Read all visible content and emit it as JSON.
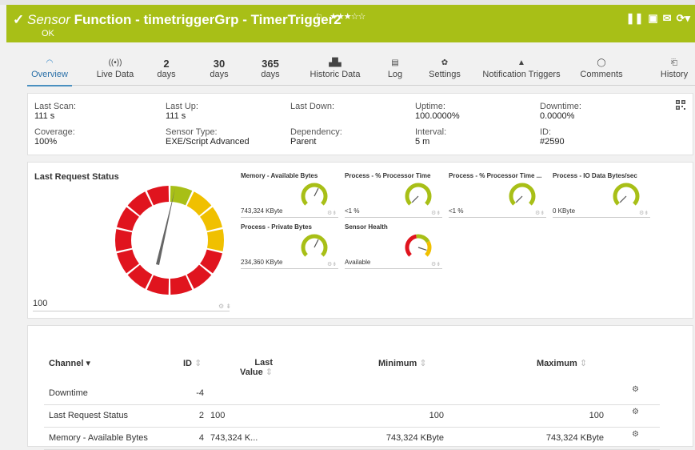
{
  "header": {
    "prefix": "Sensor",
    "title": "Function - timetriggerGrp - TimerTrigger2",
    "status": "OK",
    "stars": "★★★☆☆"
  },
  "tabs": [
    {
      "icon": "gauge-icon",
      "glyph": "◠",
      "label": "Overview",
      "active": true
    },
    {
      "icon": "live-data-icon",
      "glyph": "((•))",
      "label": "Live Data"
    },
    {
      "value": "2",
      "label": "days"
    },
    {
      "value": "30",
      "label": "days"
    },
    {
      "value": "365",
      "label": "days"
    },
    {
      "icon": "historic-data-icon",
      "glyph": "▟▙",
      "label": "Historic Data"
    },
    {
      "icon": "log-icon",
      "glyph": "▤",
      "label": "Log"
    },
    {
      "icon": "settings-icon",
      "glyph": "✿",
      "label": "Settings"
    },
    {
      "icon": "bell-icon",
      "glyph": "▲",
      "label": "Notification Triggers"
    },
    {
      "icon": "comment-icon",
      "glyph": "◯",
      "label": "Comments"
    },
    {
      "icon": "history-icon",
      "glyph": "⎗",
      "label": "History"
    }
  ],
  "info": {
    "last_scan": {
      "label": "Last Scan:",
      "value": "111 s"
    },
    "last_up": {
      "label": "Last Up:",
      "value": "111 s"
    },
    "last_down": {
      "label": "Last Down:",
      "value": ""
    },
    "uptime": {
      "label": "Uptime:",
      "value": "100.0000%"
    },
    "downtime": {
      "label": "Downtime:",
      "value": "0.0000%"
    },
    "coverage": {
      "label": "Coverage:",
      "value": "100%"
    },
    "sensor_type": {
      "label": "Sensor Type:",
      "value": "EXE/Script Advanced"
    },
    "dependency": {
      "label": "Dependency:",
      "value": "Parent"
    },
    "interval": {
      "label": "Interval:",
      "value": "5 m"
    },
    "id": {
      "label": "ID:",
      "value": "#2590"
    }
  },
  "gauges": {
    "main": {
      "title": "Last Request Status",
      "value": "100"
    },
    "mini": [
      {
        "title": "Memory - Available Bytes",
        "value": "743,324 KByte",
        "level": 0.6
      },
      {
        "title": "Process - % Processor Time",
        "value": "<1 %",
        "level": 0.0
      },
      {
        "title": "Process - % Processor Time ...",
        "value": "<1 %",
        "level": 0.0
      },
      {
        "title": "Process - IO Data Bytes/sec",
        "value": "0 KByte",
        "level": 0.0
      },
      {
        "title": "Process - Private Bytes",
        "value": "234,360 KByte",
        "level": 0.6
      },
      {
        "title": "Sensor Health",
        "value": "Available",
        "level": 0.9
      }
    ]
  },
  "table": {
    "headers": {
      "channel": "Channel",
      "id": "ID",
      "last_value_1": "Last",
      "last_value_2": "Value",
      "minimum": "Minimum",
      "maximum": "Maximum"
    },
    "rows": [
      {
        "channel": "Downtime",
        "id": "-4",
        "last": "",
        "min": "",
        "max": ""
      },
      {
        "channel": "Last Request Status",
        "id": "2",
        "last": "100",
        "min": "100",
        "max": "100"
      },
      {
        "channel": "Memory - Available Bytes",
        "id": "4",
        "last": "743,324 K...",
        "min": "743,324 KByte",
        "max": "743,324 KByte"
      }
    ]
  },
  "colors": {
    "header": "#a8bf17",
    "red": "#e0141e",
    "yellow": "#f0c000",
    "green": "#a8bf17"
  }
}
